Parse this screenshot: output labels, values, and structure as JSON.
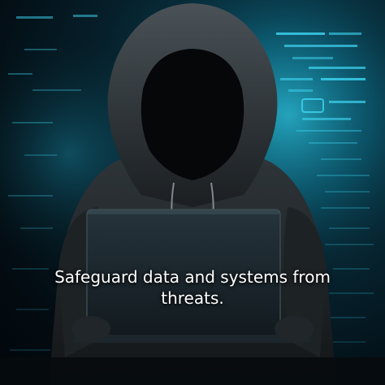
{
  "caption": {
    "line1": "Safeguard data and systems from",
    "line2": "threats."
  },
  "colors": {
    "background": "#02070b",
    "glow": "#19c6e6",
    "hoodie": "#2a2f33",
    "laptop": "#1a2730",
    "caption_text": "#ffffff"
  },
  "icons": [
    "hooded-figure-illustration",
    "laptop-illustration",
    "code-glow-background"
  ]
}
